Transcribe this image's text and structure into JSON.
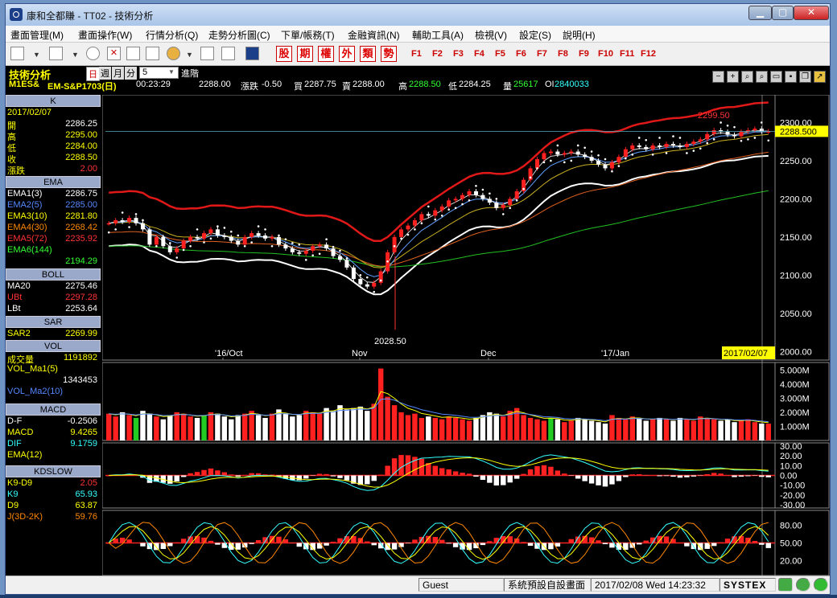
{
  "window": {
    "title": "康和全都賺 - TT02 - 技術分析"
  },
  "menu": [
    "畫面管理(M)",
    "畫面操作(W)",
    "行情分析(Q)",
    "走勢分析圖(C)",
    "下單/帳務(T)",
    "金融資訊(N)",
    "輔助工具(A)",
    "檢視(V)",
    "設定(S)",
    "說明(H)"
  ],
  "toolbar": {
    "red_buttons": [
      "股",
      "期",
      "權",
      "外",
      "類",
      "勢"
    ],
    "fkeys": [
      "F1",
      "F2",
      "F3",
      "F4",
      "F5",
      "F6",
      "F7",
      "F8",
      "F9",
      "F10",
      "F11",
      "F12"
    ]
  },
  "panel": {
    "title": "技術分析",
    "periods": [
      "日",
      "週",
      "月",
      "分"
    ],
    "period_selected": "日",
    "minute_value": "5",
    "advanced_label": "進階",
    "tools": [
      "minus",
      "plus",
      "zoom-in",
      "zoom-out",
      "print",
      "save",
      "restore",
      "export"
    ]
  },
  "quote": {
    "symbol": "M1ES&",
    "contract": "EM-S&P1703(日)",
    "time": "00:23:29",
    "price": "2288.00",
    "change_label": "漲跌",
    "change": "-0.50",
    "bid_label": "買",
    "bid": "2287.75",
    "ask_label": "賣",
    "ask": "2288.00",
    "high_label": "高",
    "high": "2288.50",
    "low_label": "低",
    "low": "2284.25",
    "volume_label": "量",
    "volume": "25617",
    "oi_label": "OI",
    "oi": "2840033"
  },
  "left_panel": {
    "k": {
      "header": "K",
      "date": "2017/02/07",
      "rows": [
        {
          "label": "開",
          "value": "2286.25"
        },
        {
          "label": "高",
          "value": "2295.00"
        },
        {
          "label": "低",
          "value": "2284.00"
        },
        {
          "label": "收",
          "value": "2288.50"
        },
        {
          "label": "漲跌",
          "value": "2.00"
        }
      ]
    },
    "ema": {
      "header": "EMA",
      "rows": [
        {
          "label": "EMA1(3)",
          "value": "2286.75"
        },
        {
          "label": "EMA2(5)",
          "value": "2285.00"
        },
        {
          "label": "EMA3(10)",
          "value": "2281.80"
        },
        {
          "label": "EMA4(30)",
          "value": "2268.42"
        },
        {
          "label": "EMA5(72)",
          "value": "2235.92"
        },
        {
          "label": "EMA6(144)",
          "value": "2194.29"
        }
      ]
    },
    "boll": {
      "header": "BOLL",
      "rows": [
        {
          "label": "MA20",
          "value": "2275.46"
        },
        {
          "label": "UBt",
          "value": "2297.28"
        },
        {
          "label": "LBt",
          "value": "2253.64"
        }
      ]
    },
    "sar": {
      "header": "SAR",
      "rows": [
        {
          "label": "SAR2",
          "value": "2269.99"
        }
      ]
    },
    "vol": {
      "header": "VOL",
      "rows": [
        {
          "label": "成交量",
          "value": "1191892"
        },
        {
          "label": "VOL_Ma1(5)",
          "value": "1343453"
        },
        {
          "label": "VOL_Ma2(10)",
          "value": ""
        }
      ]
    },
    "macd": {
      "header": "MACD",
      "rows": [
        {
          "label": "D-F",
          "value": "-0.2506"
        },
        {
          "label": "MACD",
          "value": "9.4265"
        },
        {
          "label": "DIF",
          "value": "9.1759"
        },
        {
          "label": "EMA(12)",
          "value": ""
        }
      ]
    },
    "kd": {
      "header": "KDSLOW",
      "rows": [
        {
          "label": "K9-D9",
          "value": "2.05"
        },
        {
          "label": "K9",
          "value": "65.93"
        },
        {
          "label": "D9",
          "value": "63.87"
        },
        {
          "label": "J(3D-2K)",
          "value": "59.76"
        }
      ]
    }
  },
  "colors": {
    "up": "#ff2020",
    "down": "#ffffff",
    "boll": "#e01818",
    "sar": "#ffffff",
    "ema6": "#22c022",
    "ema5": "#e06020",
    "ema4": "#c8b020",
    "ema3": "#60a0ff"
  },
  "chart_data": [
    {
      "type": "candlestick",
      "title": "EM-S&P1703(日)",
      "x_labels": [
        "'16/Oct",
        "Nov",
        "Dec",
        "'17/Jan"
      ],
      "current_date": "2017/02/07",
      "y_ticks": [
        2000,
        2050,
        2100,
        2150,
        2200,
        2250,
        2300
      ],
      "ylim": [
        1995,
        2330
      ],
      "annotations": [
        {
          "label": "2299.50",
          "value": 2299.5
        },
        {
          "label": "2028.50",
          "value": 2028.5
        }
      ],
      "last_price_label": "2288.500",
      "last_price": 2288.5,
      "series_close": [
        2168,
        2172,
        2170,
        2175,
        2168,
        2160,
        2140,
        2150,
        2138,
        2130,
        2135,
        2145,
        2150,
        2148,
        2155,
        2160,
        2152,
        2150,
        2145,
        2140,
        2150,
        2155,
        2152,
        2148,
        2150,
        2140,
        2135,
        2130,
        2128,
        2132,
        2138,
        2140,
        2135,
        2125,
        2120,
        2110,
        2095,
        2088,
        2085,
        2090,
        2105,
        2130,
        2150,
        2160,
        2165,
        2172,
        2180,
        2178,
        2185,
        2190,
        2198,
        2200,
        2205,
        2210,
        2205,
        2200,
        2195,
        2188,
        2192,
        2200,
        2210,
        2225,
        2240,
        2252,
        2260,
        2262,
        2258,
        2260,
        2262,
        2258,
        2255,
        2250,
        2245,
        2240,
        2248,
        2255,
        2265,
        2270,
        2268,
        2265,
        2270,
        2268,
        2272,
        2270,
        2268,
        2272,
        2275,
        2278,
        2285,
        2290,
        2288,
        2284,
        2282,
        2288,
        2290,
        2292,
        2288,
        2288.5
      ]
    },
    {
      "type": "bar",
      "title": "VOL",
      "y_ticks": [
        "1.000M",
        "2.000M",
        "3.000M",
        "4.000M",
        "5.000M"
      ],
      "ylim": [
        0,
        5.3
      ],
      "values_m": [
        1.9,
        1.7,
        2.0,
        1.8,
        1.6,
        2.1,
        1.9,
        1.7,
        1.5,
        1.8,
        2.0,
        1.9,
        1.7,
        1.6,
        1.8,
        2.0,
        1.9,
        1.7,
        1.5,
        1.8,
        1.9,
        2.1,
        1.8,
        1.6,
        1.9,
        2.2,
        1.9,
        1.7,
        1.8,
        2.1,
        2.0,
        1.9,
        2.3,
        2.1,
        2.5,
        2.2,
        2.3,
        2.4,
        2.1,
        2.6,
        5.1,
        3.1,
        2.5,
        2.0,
        1.8,
        1.9,
        1.6,
        1.7,
        1.6,
        1.5,
        1.7,
        1.6,
        1.5,
        1.4,
        1.6,
        1.8,
        2.0,
        1.9,
        1.7,
        2.1,
        2.3,
        1.8,
        1.6,
        1.5,
        1.4,
        1.6,
        1.5,
        1.3,
        1.4,
        1.6,
        1.5,
        1.4,
        1.3,
        1.2,
        1.8,
        1.6,
        1.5,
        1.7,
        1.6,
        1.4,
        1.5,
        1.6,
        1.5,
        1.4,
        1.6,
        1.5,
        1.4,
        1.7,
        1.6,
        1.5,
        1.4,
        1.5,
        1.3,
        1.4,
        1.5,
        1.3,
        1.2,
        1.19
      ]
    },
    {
      "type": "line",
      "title": "MACD",
      "y_ticks": [
        "-30.00",
        "-20.00",
        "-10.00",
        "0.00",
        "10.00",
        "20.00",
        "30.00"
      ],
      "ylim": [
        -30,
        30
      ]
    },
    {
      "type": "line",
      "title": "KDSLOW",
      "y_ticks": [
        "20.00",
        "50.00",
        "80.00"
      ],
      "ylim": [
        0,
        100
      ]
    }
  ],
  "status": {
    "user": "Guest",
    "screen": "系統預設自設畫面",
    "datetime": "2017/02/08 Wed 14:23:32",
    "brand": "SYSTEX"
  }
}
